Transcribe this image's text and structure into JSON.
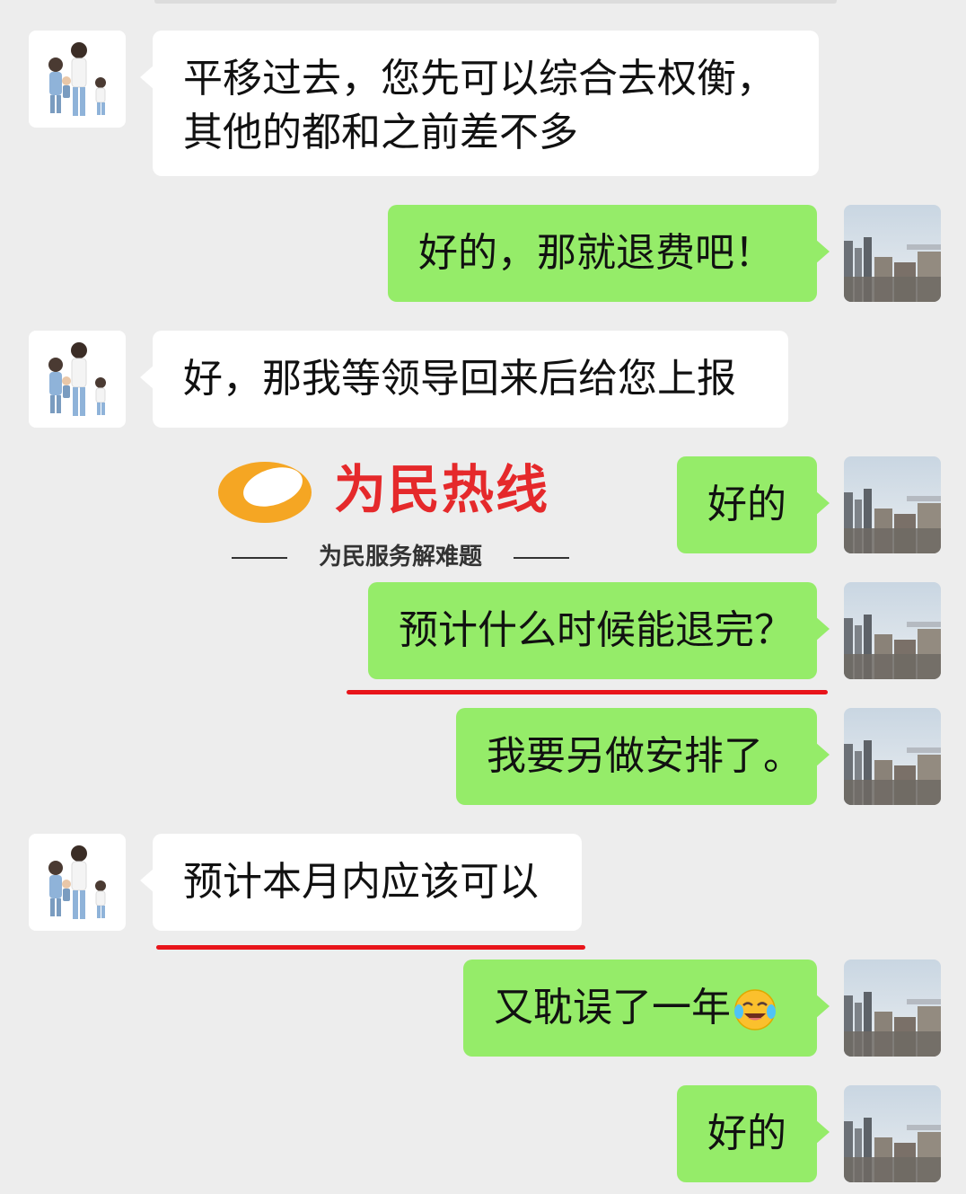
{
  "messages": [
    {
      "side": "in",
      "lines": [
        "平移过去，您先可以综合去权衡，",
        "其他的都和之前差不多"
      ]
    },
    {
      "side": "out",
      "text": "好的，那就退费吧！"
    },
    {
      "side": "in",
      "text": "好，那我等领导回来后给您上报"
    },
    {
      "side": "out",
      "text": "好的"
    },
    {
      "side": "out",
      "text": "预计什么时候能退完？"
    },
    {
      "side": "out",
      "text": "我要另做安排了。"
    },
    {
      "side": "in",
      "text": "预计本月内应该可以"
    },
    {
      "side": "out",
      "text": "又耽误了一年",
      "emoji": "crying-laughing-emoji"
    },
    {
      "side": "out",
      "text": "好的"
    }
  ],
  "watermark": {
    "title": "为民热线",
    "subtitle": "为民服务解难题"
  },
  "colors": {
    "background": "#ededed",
    "incoming_bubble": "#ffffff",
    "outgoing_bubble": "#95ec69",
    "highlight_underline": "#e8141a",
    "watermark_red": "#e5292b",
    "watermark_orange": "#f5a623"
  }
}
